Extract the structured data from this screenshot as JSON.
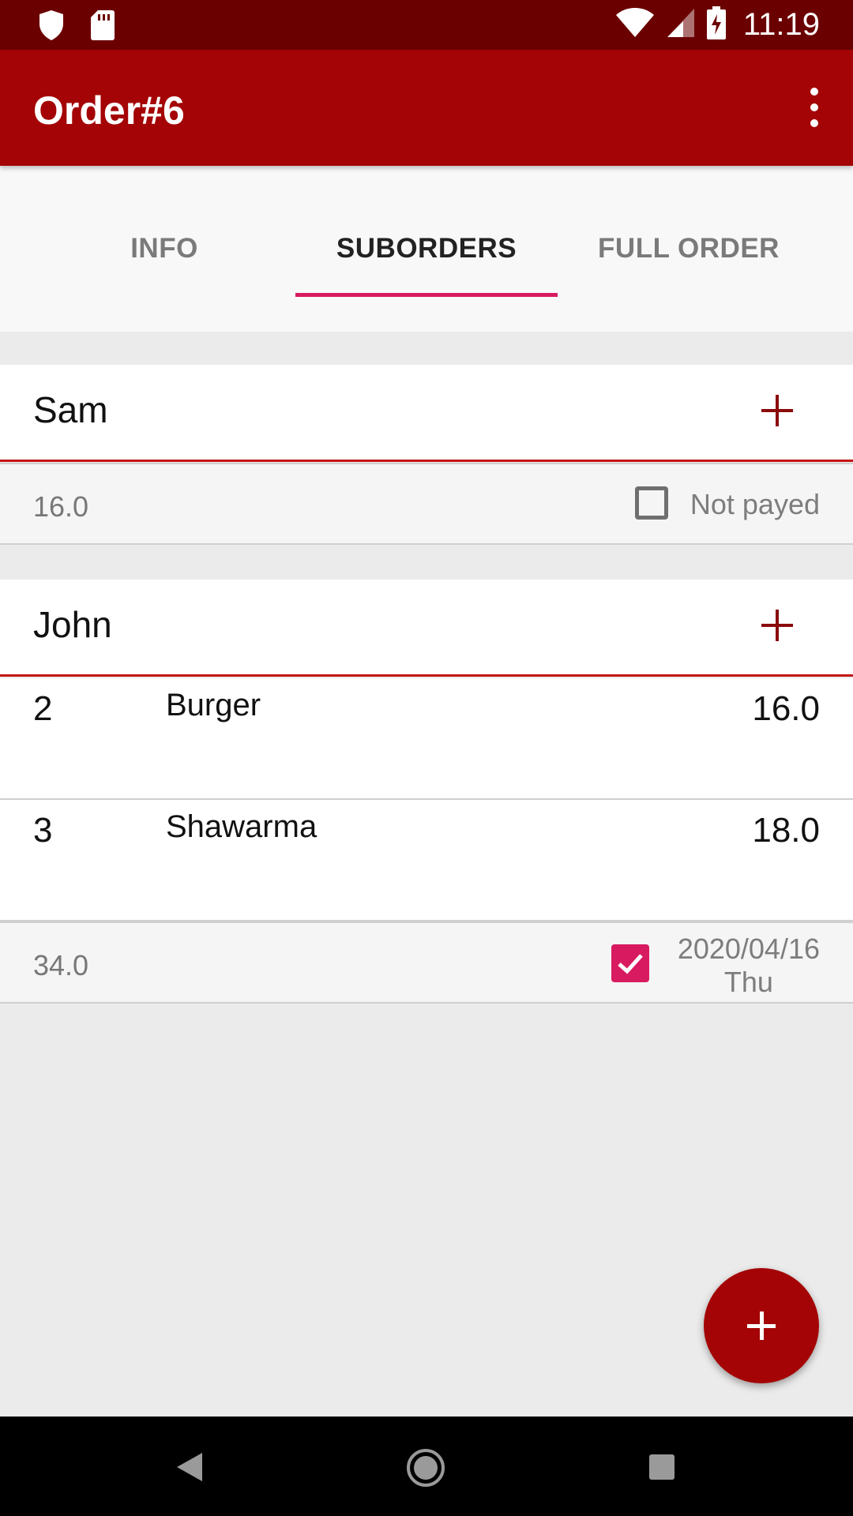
{
  "status_bar": {
    "time": "11:19",
    "left_icons": [
      "shield-icon",
      "sd-card-icon"
    ],
    "right_icons": [
      "wifi-icon",
      "cellular-signal-icon",
      "battery-charging-icon"
    ]
  },
  "app_bar": {
    "title": "Order#6",
    "overflow_icon": "more-vertical-icon"
  },
  "tabs": [
    {
      "label": "INFO",
      "active": false
    },
    {
      "label": "SUBORDERS",
      "active": true
    },
    {
      "label": "FULL ORDER",
      "active": false
    }
  ],
  "suborders": [
    {
      "name": "Sam",
      "items": [],
      "total": "16.0",
      "payed": false,
      "status_label": "Not payed"
    },
    {
      "name": "John",
      "items": [
        {
          "qty": "2",
          "name": "Burger",
          "price": "16.0"
        },
        {
          "qty": "3",
          "name": "Shawarma",
          "price": "18.0"
        }
      ],
      "total": "34.0",
      "payed": true,
      "paid_date": "2020/04/16",
      "paid_day": "Thu"
    }
  ],
  "fab_icon": "add-icon",
  "nav_bar": [
    "back-icon",
    "home-icon",
    "recents-icon"
  ],
  "colors": {
    "status_bar": "#6b0000",
    "primary": "#a40405",
    "accent": "#d81b60",
    "add_icon": "#8a0a0a"
  }
}
